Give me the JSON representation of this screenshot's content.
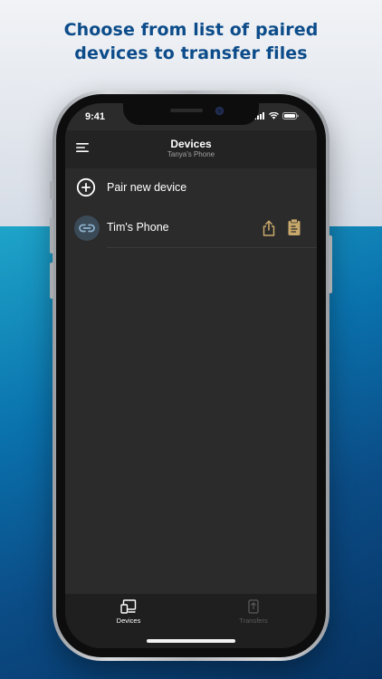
{
  "headline": {
    "line1": "Choose from list of paired",
    "line2": "devices to transfer files"
  },
  "status_bar": {
    "time": "9:41"
  },
  "nav": {
    "title": "Devices",
    "subtitle": "Tanya's Phone",
    "menu_icon": "hamburger-menu-icon"
  },
  "list": {
    "pair_new": {
      "label": "Pair new device",
      "icon": "plus-circle-icon"
    },
    "devices": [
      {
        "name": "Tim's Phone",
        "icon": "link-icon",
        "actions": [
          "share-upload-icon",
          "clipboard-icon"
        ]
      }
    ]
  },
  "tabs": [
    {
      "label": "Devices",
      "icon": "devices-icon",
      "active": true
    },
    {
      "label": "Transfers",
      "icon": "transfers-icon",
      "active": false
    }
  ],
  "colors": {
    "headline": "#0c4c8a",
    "screen_bg": "#2b2b2b",
    "nav_bg": "#232323",
    "tab_bar_bg": "#1f1f1f",
    "accent_gold": "#c9a96b",
    "link_avatar_bg": "#3b4a57",
    "link_icon": "#8fb3cf"
  }
}
